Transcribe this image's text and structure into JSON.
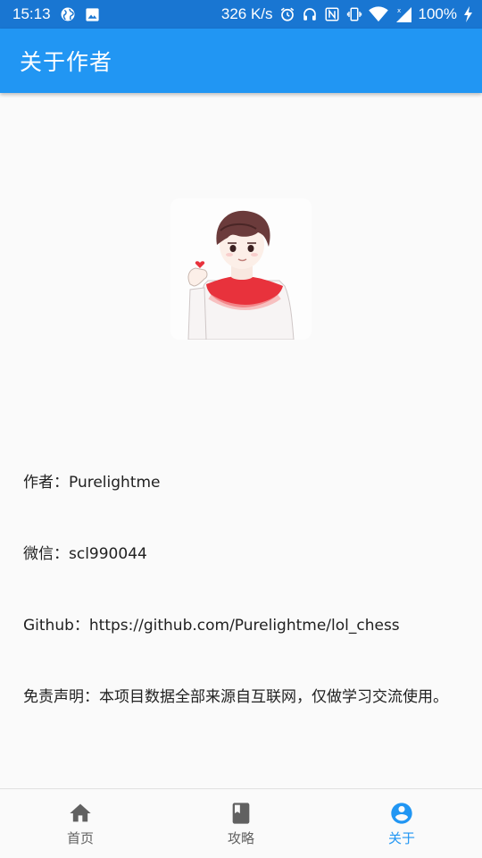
{
  "status_bar": {
    "time": "15:13",
    "speed": "326 K/s",
    "battery": "100%",
    "icons": [
      "globe-icon",
      "image-icon",
      "alarm-icon",
      "headset-icon",
      "nfc-icon",
      "vibrate-icon",
      "wifi-icon",
      "signal-icon",
      "charging-icon"
    ]
  },
  "app_bar": {
    "title": "关于作者"
  },
  "avatar": {
    "icon": "author-avatar-illustration"
  },
  "info": {
    "author_label": "作者：",
    "author_value": "Purelightme",
    "wechat_label": "微信：",
    "wechat_value": "scl990044",
    "github_label": "Github：",
    "github_value": "https://github.com/Purelightme/lol_chess",
    "disclaimer_label": "免责声明：",
    "disclaimer_value": "本项目数据全部来源自互联网，仅做学习交流使用。"
  },
  "bottom_nav": {
    "items": [
      {
        "label": "首页",
        "icon": "home-icon",
        "active": false
      },
      {
        "label": "攻略",
        "icon": "book-icon",
        "active": false
      },
      {
        "label": "关于",
        "icon": "account-circle-icon",
        "active": true
      }
    ]
  },
  "colors": {
    "primary": "#2196f3",
    "status_bar": "#1976d2",
    "inactive": "#616161",
    "background": "#fafafa"
  }
}
